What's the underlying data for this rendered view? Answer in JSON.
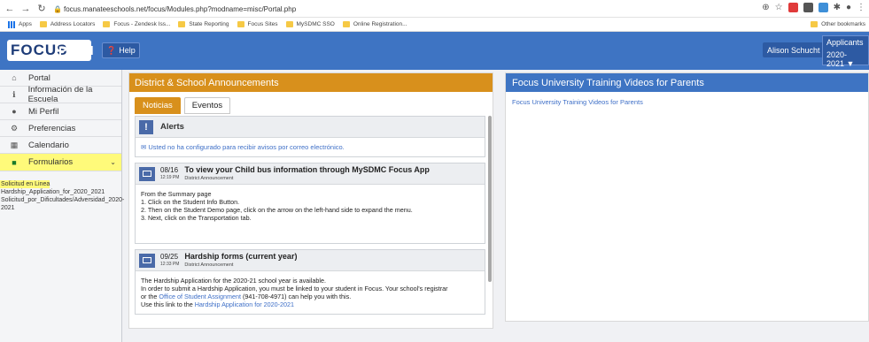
{
  "browser": {
    "url": "focus.manateeschools.net/focus/Modules.php?modname=misc/Portal.php",
    "bookmarks": [
      "Apps",
      "Address Locators",
      "Focus - Zendesk Iss...",
      "State Reporting",
      "Focus Sites",
      "MySDMC SSO",
      "Online Registration..."
    ],
    "other_bookmarks": "Other bookmarks"
  },
  "header": {
    "logo": "FOCUS",
    "portal_title": "Portal",
    "help_label": "Help",
    "user_name": "Alison Schucht",
    "applicants_label": "Applicants",
    "year_label": "2020-2021 ▼"
  },
  "sidebar": {
    "items": [
      {
        "label": "Portal",
        "icon": "home-icon"
      },
      {
        "label": "Información de la Escuela",
        "icon": "info-icon"
      },
      {
        "label": "Mi Perfil",
        "icon": "user-icon"
      },
      {
        "label": "Preferencias",
        "icon": "gear-icon"
      },
      {
        "label": "Calendario",
        "icon": "calendar-icon"
      },
      {
        "label": "Formularios",
        "icon": "document-icon"
      }
    ],
    "subitems": [
      "Solicitud en Linea",
      "Hardship_Application_for_2020_2021",
      "Solicitud_por_Dificultades/Adversidad_2020-2021"
    ]
  },
  "announcements": {
    "title": "District & School Announcements",
    "tabs": [
      "Noticias",
      "Eventos"
    ],
    "alerts": {
      "title": "Alerts",
      "message": "Usted no ha configurado para recibir avisos por correo electrónico."
    },
    "news": [
      {
        "date": "08/16",
        "time": "12:19 PM",
        "title": "To view your Child bus information through MySDMC Focus App",
        "source": "District Announcement",
        "lines": [
          "From the Summary page",
          "1. Click on the Student Info Button.",
          "2. Then on the Student Demo page, click on the arrow on the left-hand side to expand the menu.",
          "3. Next, click on the Transportation tab."
        ]
      },
      {
        "date": "09/25",
        "time": "12:33 PM",
        "title": "Hardship forms (current year)",
        "source": "District Announcement",
        "lines": [
          "The Hardship Application for the 2020-21 school year is available.",
          "In order to submit a Hardship Application, you must be linked to your student in Focus.  Your school's registrar"
        ],
        "line3_pre": "or the ",
        "line3_link": "Office of Student Assignment",
        "line3_post": " (941-708-4971) can help you with this.",
        "line4_pre": "Use this link to the ",
        "line4_link": "Hardship Application for 2020-2021"
      }
    ]
  },
  "training": {
    "title": "Focus University Training Videos for Parents",
    "link": "Focus University Training Videos for Parents"
  }
}
